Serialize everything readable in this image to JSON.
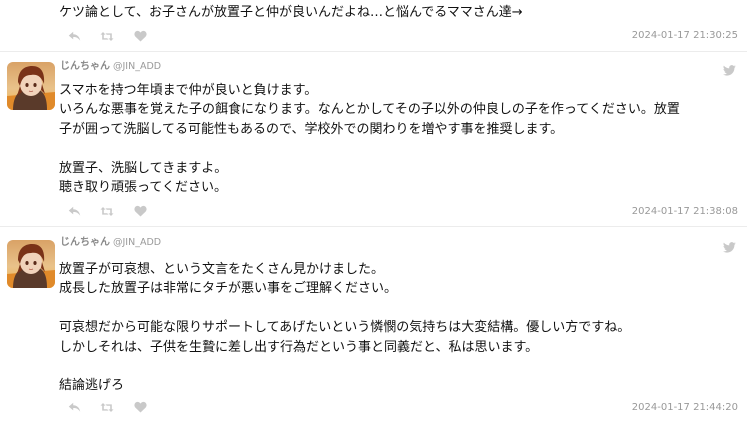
{
  "tweets": [
    {
      "lines": [
        "ケツ論として、お子さんが放置子と仲が良いんだよね…と悩んでるママさん達→"
      ],
      "timestamp": "2024-01-17 21:30:25"
    },
    {
      "display_name": "じんちゃん",
      "handle": "@JIN_ADD",
      "lines": [
        "スマホを持つ年頃まで仲が良いと負けます。",
        "いろんな悪事を覚えた子の餌食になります。なんとかしてその子以外の仲良しの子を作ってください。放置",
        "子が囲って洗脳してる可能性もあるので、学校外での関わりを増やす事を推奨します。",
        "",
        "放置子、洗脳してきますよ。",
        "聴き取り頑張ってください。"
      ],
      "timestamp": "2024-01-17 21:38:08"
    },
    {
      "display_name": "じんちゃん",
      "handle": "@JIN_ADD",
      "lines": [
        "放置子が可哀想、という文言をたくさん見かけました。",
        "成長した放置子は非常にタチが悪い事をご理解ください。",
        "",
        "可哀想だから可能な限りサポートしてあげたいという憐憫の気持ちは大変結構。優しい方ですね。",
        "しかしそれは、子供を生贄に差し出す行為だという事と同義だと、私は思います。",
        "",
        "結論逃げろ"
      ],
      "timestamp": "2024-01-17 21:44:20"
    }
  ],
  "icons": {
    "reply": "reply-icon",
    "retweet": "retweet-icon",
    "like": "heart-icon",
    "twitter": "twitter-bird-icon"
  },
  "colors": {
    "icon_gray": "#c9c9c9",
    "meta_gray": "#999999",
    "name_gray": "#8a8a8a",
    "text": "#111111"
  }
}
